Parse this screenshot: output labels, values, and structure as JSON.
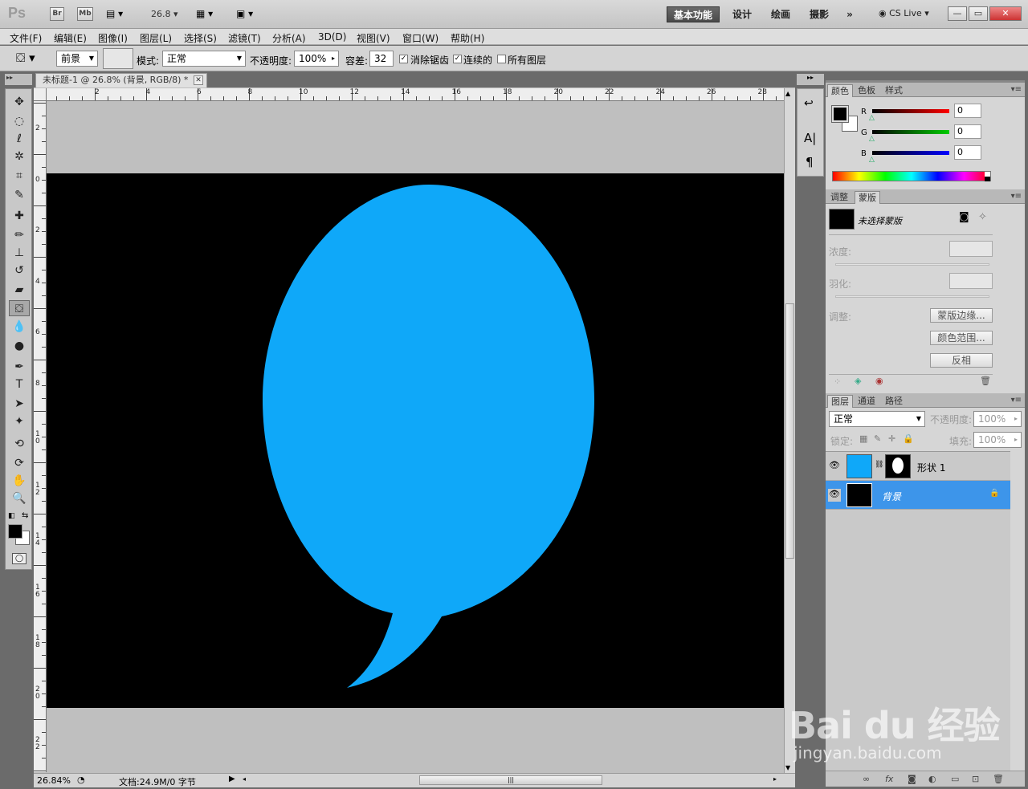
{
  "app": {
    "logo": "Ps",
    "bridge": "Br",
    "minibridge": "Mb",
    "zoom_value": "26.8"
  },
  "workspaces": [
    "基本功能",
    "设计",
    "绘画",
    "摄影"
  ],
  "more_workspaces": "»",
  "cslive": "CS Live",
  "window_controls": [
    "—",
    "▭",
    "✕"
  ],
  "menu": [
    "文件(F)",
    "编辑(E)",
    "图像(I)",
    "图层(L)",
    "选择(S)",
    "滤镜(T)",
    "分析(A)",
    "3D(D)",
    "视图(V)",
    "窗口(W)",
    "帮助(H)"
  ],
  "options": {
    "fill_source": "前景",
    "mode_label": "模式:",
    "mode_value": "正常",
    "opacity_label": "不透明度:",
    "opacity_value": "100%",
    "tolerance_label": "容差:",
    "tolerance_value": "32",
    "antialias_label": "消除锯齿",
    "contiguous_label": "连续的",
    "all_layers_label": "所有图层"
  },
  "document": {
    "tab_title": "未标题-1 @ 26.8% (背景, RGB/8) *",
    "hruler_labels": [
      "2",
      "4",
      "6",
      "8",
      "10",
      "12",
      "14",
      "16",
      "18",
      "20",
      "22",
      "24",
      "26",
      "28"
    ],
    "vruler_labels": [
      "2",
      "0",
      "2",
      "4",
      "6",
      "8",
      "10",
      "12",
      "14",
      "16",
      "18",
      "20",
      "22"
    ],
    "canvas_color": "#000000",
    "shape_color": "#0FA8F9"
  },
  "status": {
    "zoom": "26.84%",
    "doc_info": "文档:24.9M/0 字节"
  },
  "color_panel": {
    "tabs": [
      "颜色",
      "色板",
      "样式"
    ],
    "channels": [
      {
        "label": "R",
        "value": "0"
      },
      {
        "label": "G",
        "value": "0"
      },
      {
        "label": "B",
        "value": "0"
      }
    ]
  },
  "masks_panel": {
    "tabs": [
      "调整",
      "蒙版"
    ],
    "mask_label": "未选择蒙版",
    "density_label": "浓度:",
    "feather_label": "羽化:",
    "refine_label": "调整:",
    "buttons": [
      "蒙版边缘...",
      "颜色范围...",
      "反相"
    ]
  },
  "layers_panel": {
    "tabs": [
      "图层",
      "通道",
      "路径"
    ],
    "blend_mode": "正常",
    "opacity_label": "不透明度:",
    "opacity_value": "100%",
    "lock_label": "锁定:",
    "fill_label": "填充:",
    "fill_value": "100%",
    "layers": [
      {
        "name": "形状 1",
        "thumb_color": "#0FA8F9",
        "selected": false
      },
      {
        "name": "背景",
        "thumb_color": "#000000",
        "selected": true
      }
    ],
    "bottom_icons": [
      "link-icon",
      "fx-icon",
      "mask-icon",
      "adjustment-icon",
      "group-icon",
      "new-layer-icon",
      "trash-icon"
    ],
    "bottom_glyphs": [
      "∞",
      "fx",
      "◙",
      "◐",
      "▭",
      "⊡",
      "🗑"
    ]
  },
  "colors": {
    "accent_selected": "#3d95ea",
    "shape_blue": "#0FA8F9"
  },
  "watermark": {
    "brand": "Bai du 经验",
    "url": "jingyan.baidu.com"
  }
}
